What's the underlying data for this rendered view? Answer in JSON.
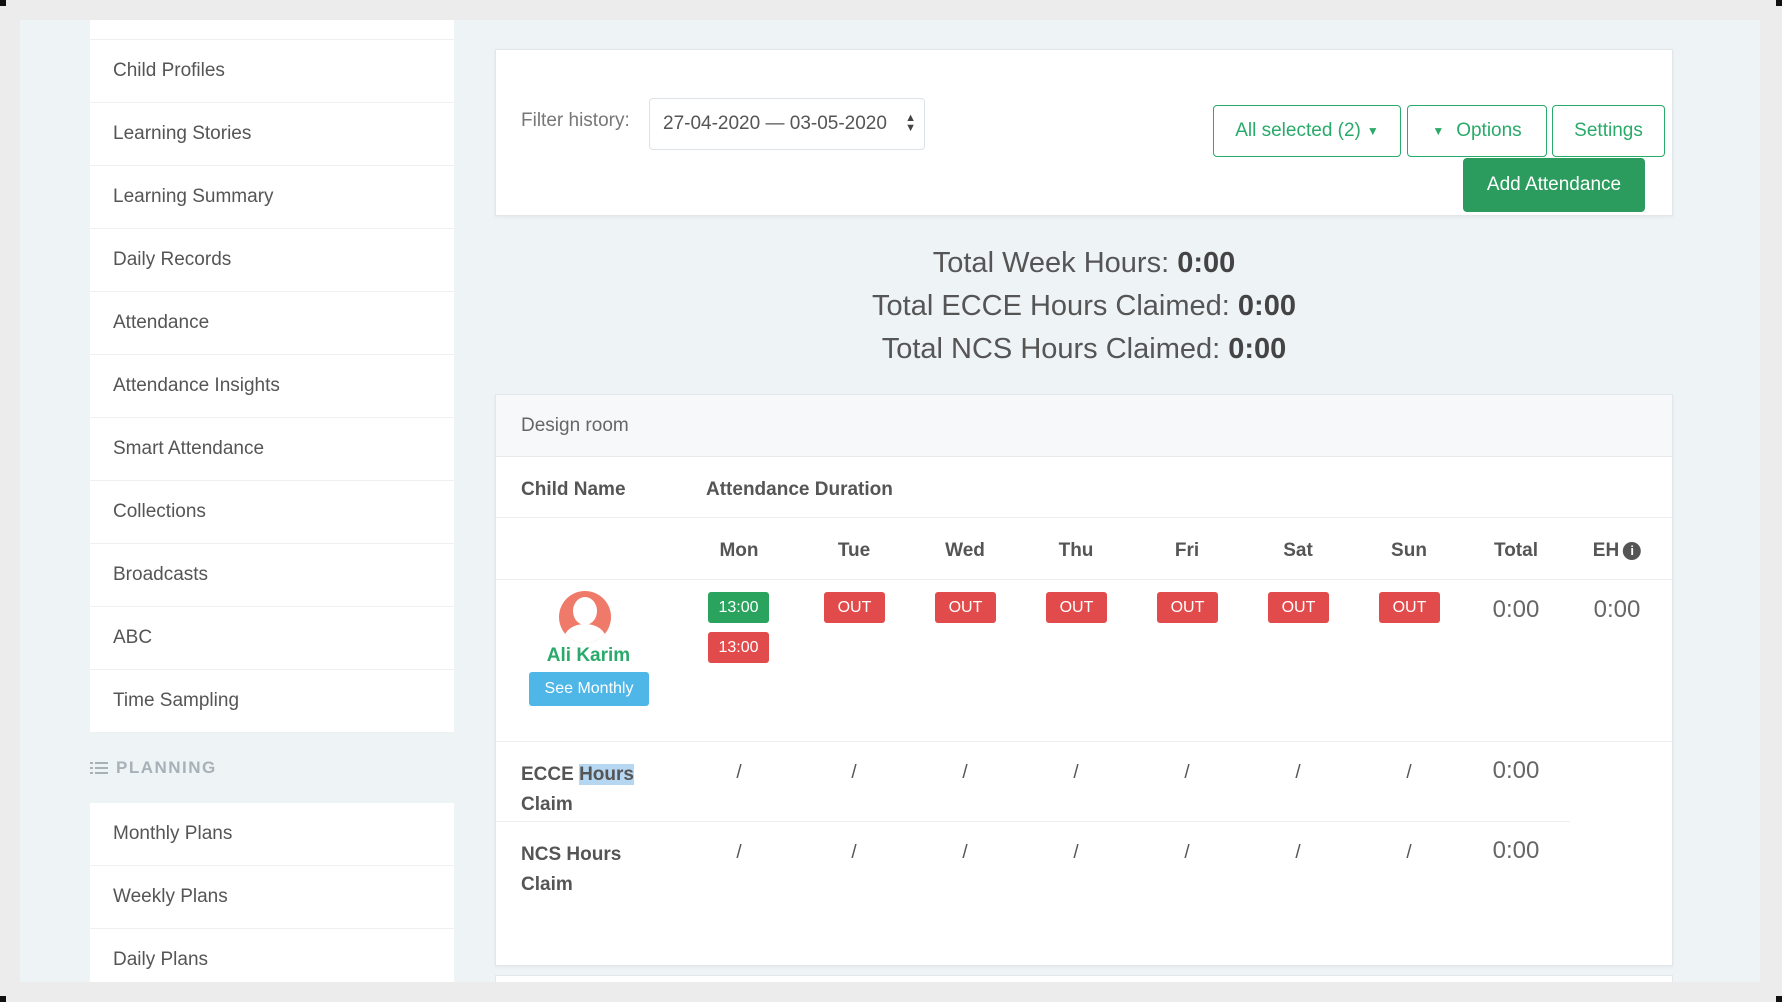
{
  "sidebar": {
    "items": [
      {
        "label": "Child Profiles"
      },
      {
        "label": "Learning Stories"
      },
      {
        "label": "Learning Summary"
      },
      {
        "label": "Daily Records"
      },
      {
        "label": "Attendance"
      },
      {
        "label": "Attendance Insights"
      },
      {
        "label": "Smart Attendance"
      },
      {
        "label": "Collections"
      },
      {
        "label": "Broadcasts"
      },
      {
        "label": "ABC"
      },
      {
        "label": "Time Sampling"
      }
    ],
    "planning_heading": "PLANNING",
    "planning_items": [
      {
        "label": "Monthly Plans"
      },
      {
        "label": "Weekly Plans"
      },
      {
        "label": "Daily Plans"
      }
    ]
  },
  "filter": {
    "label": "Filter history:",
    "date_range": "27-04-2020 — 03-05-2020",
    "all_selected": "All selected (2)",
    "options": "Options",
    "settings": "Settings",
    "add_attendance": "Add Attendance"
  },
  "totals": {
    "week_label": "Total Week Hours:",
    "week_value": "0:00",
    "ecce_label": "Total ECCE Hours Claimed:",
    "ecce_value": "0:00",
    "ncs_label": "Total NCS Hours Claimed:",
    "ncs_value": "0:00"
  },
  "table": {
    "room": "Design room",
    "col_child": "Child Name",
    "col_duration": "Attendance Duration",
    "days": [
      "Mon",
      "Tue",
      "Wed",
      "Thu",
      "Fri",
      "Sat",
      "Sun"
    ],
    "total_header": "Total",
    "eh_header": "EH",
    "child": {
      "name": "Ali Karim",
      "see_monthly": "See Monthly",
      "mon_in": "13:00",
      "mon_out": "13:00",
      "out_label": "OUT",
      "total": "0:00",
      "eh": "0:00"
    },
    "ecce": {
      "label_a": "ECCE ",
      "label_b": "Hours",
      "label_c": "Claim",
      "slash": "/",
      "total": "0:00"
    },
    "ncs": {
      "label": "NCS Hours Claim",
      "slash": "/",
      "total": "0:00"
    }
  },
  "colors": {
    "accent_green": "#2aaa6a",
    "out_red": "#e24b4b",
    "info_blue": "#4fb7e8"
  }
}
